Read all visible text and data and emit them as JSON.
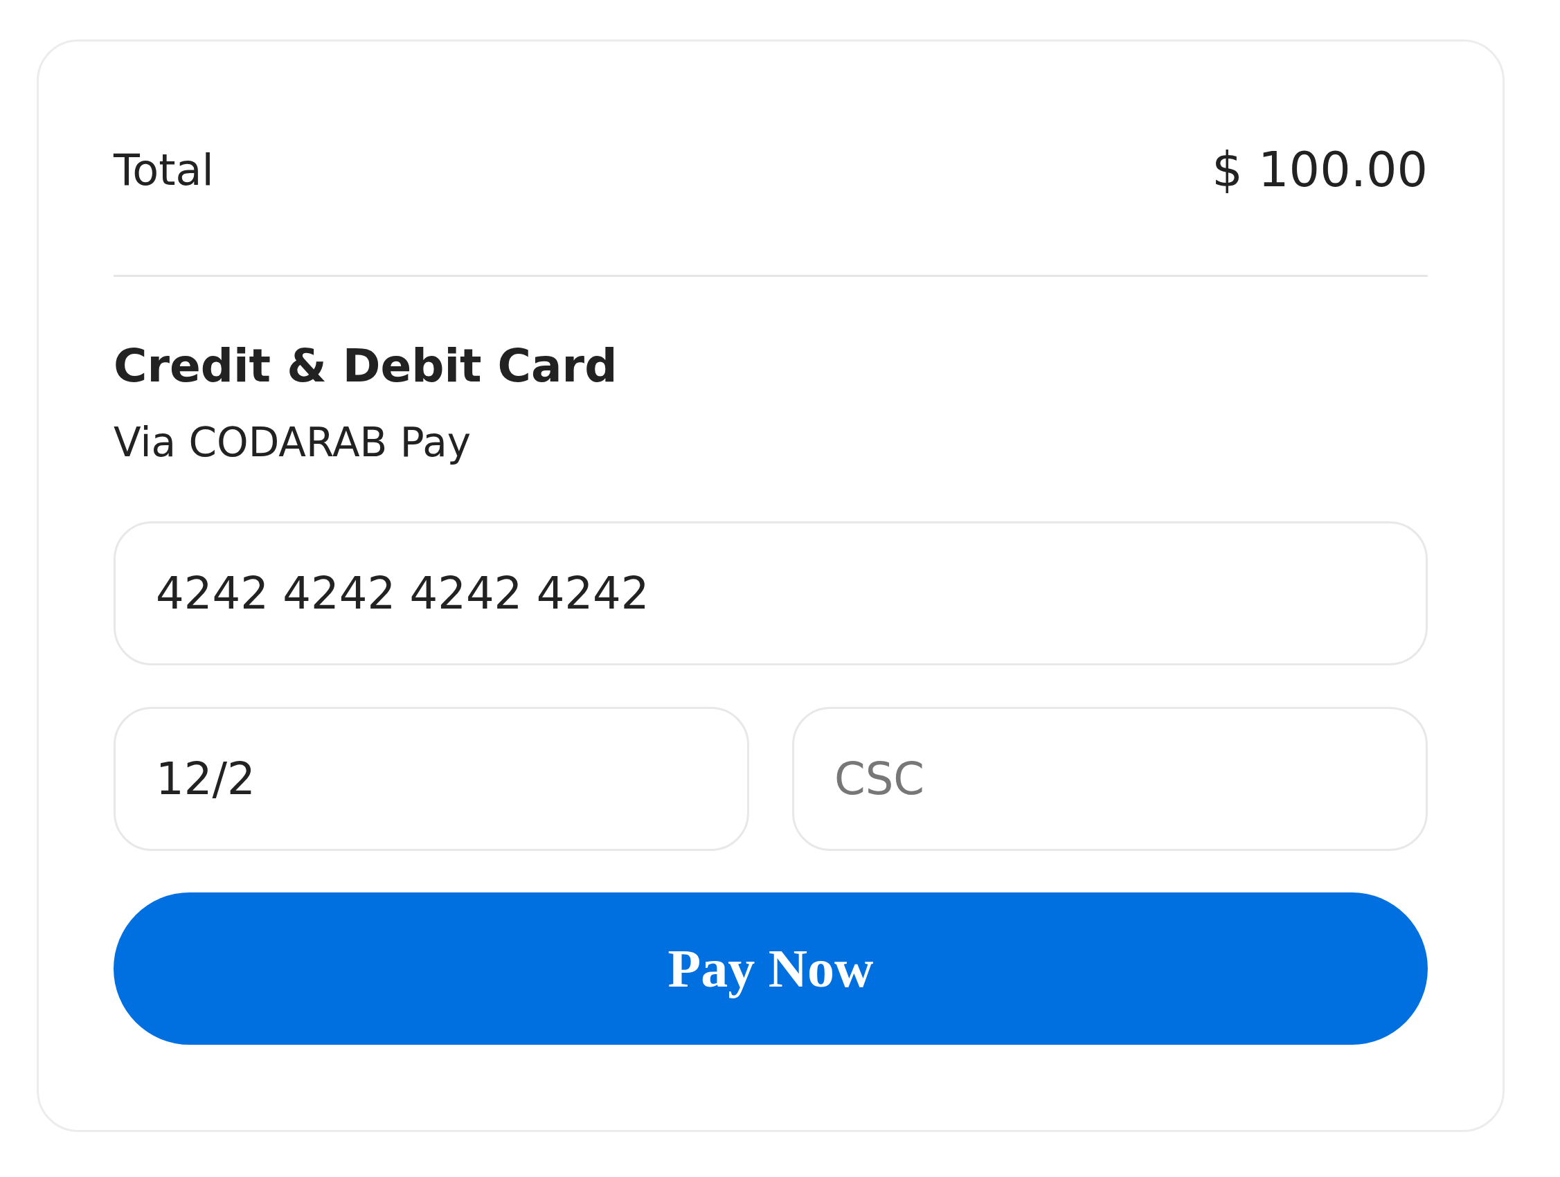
{
  "summary": {
    "label": "Total",
    "amount": "$ 100.00"
  },
  "payment_method": {
    "title": "Credit & Debit Card",
    "subtitle": "Via CODARAB Pay"
  },
  "fields": [
    {
      "kind": "card_number",
      "value": "4242 4242 4242 4242"
    },
    {
      "kind": "expiry",
      "value": "12/2"
    },
    {
      "kind": "csc",
      "placeholder": "CSC"
    }
  ],
  "button": {
    "label": "Pay Now"
  }
}
